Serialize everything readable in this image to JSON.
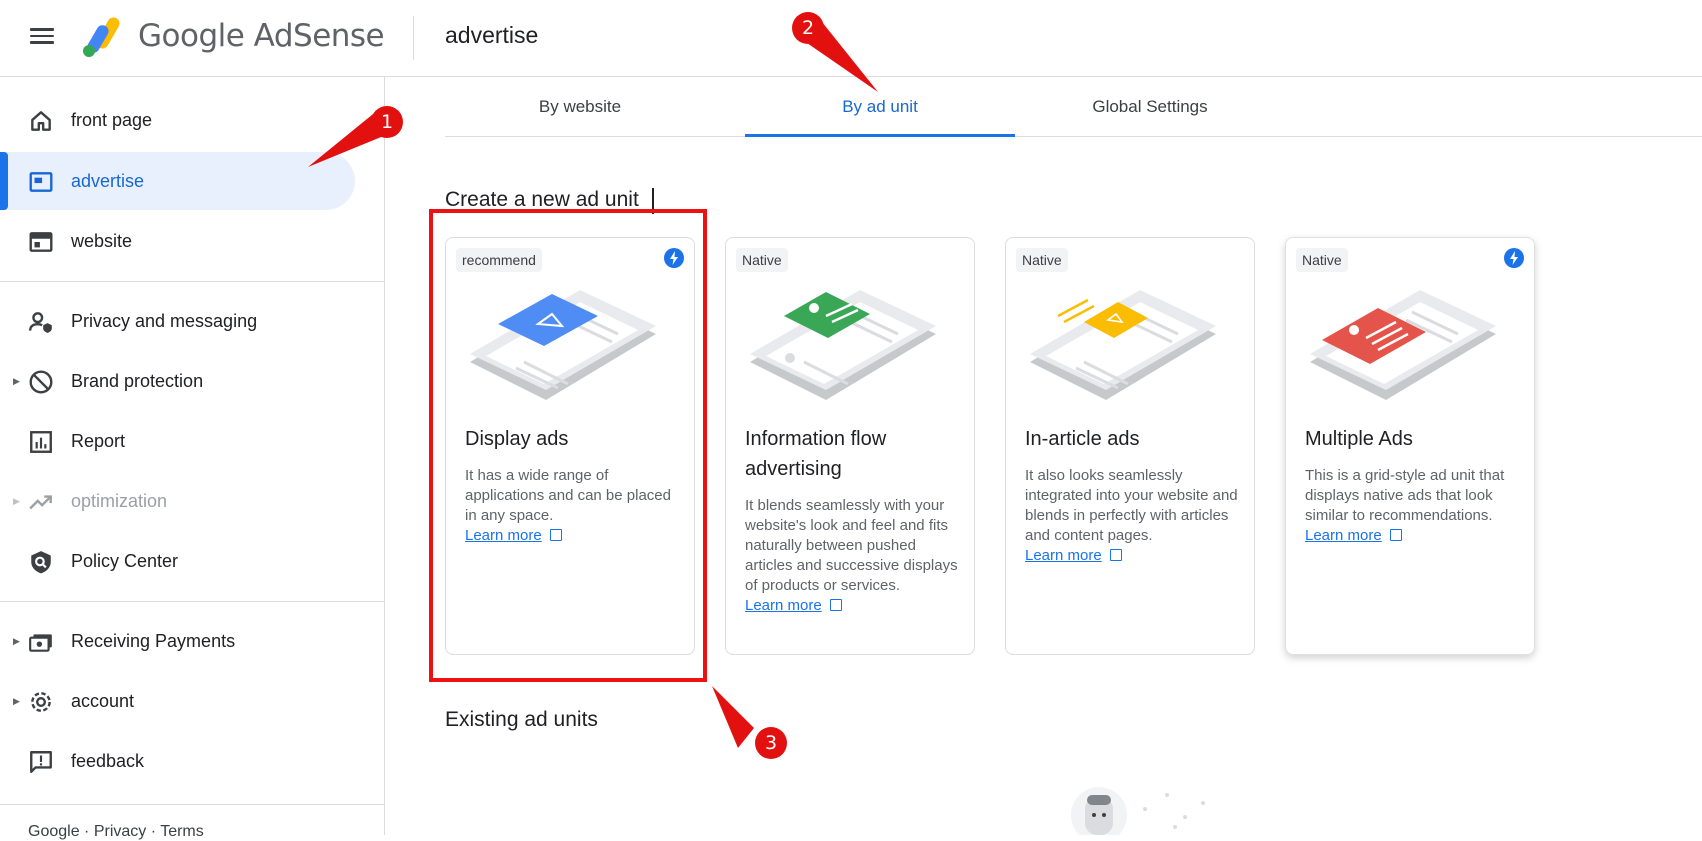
{
  "header": {
    "brand": "Google AdSense",
    "page_heading": "advertise"
  },
  "sidebar": {
    "items": [
      {
        "label": "front page",
        "icon": "home-icon"
      },
      {
        "label": "advertise",
        "icon": "ads-icon",
        "active": true
      },
      {
        "label": "website",
        "icon": "web-icon"
      },
      {
        "label": "Privacy and messaging",
        "icon": "privacy-icon"
      },
      {
        "label": "Brand protection",
        "icon": "block-icon",
        "expandable": true
      },
      {
        "label": "Report",
        "icon": "report-icon"
      },
      {
        "label": "optimization",
        "icon": "trending-icon",
        "expandable": true,
        "disabled": true
      },
      {
        "label": "Policy Center",
        "icon": "policy-icon"
      },
      {
        "label": "Receiving Payments",
        "icon": "payments-icon",
        "expandable": true
      },
      {
        "label": "account",
        "icon": "gear-icon",
        "expandable": true
      },
      {
        "label": "feedback",
        "icon": "feedback-icon"
      }
    ],
    "footer": "Google · Privacy · Terms"
  },
  "tabs": [
    {
      "label": "By website"
    },
    {
      "label": "By ad unit",
      "active": true
    },
    {
      "label": "Global Settings"
    }
  ],
  "main": {
    "create_title": "Create a new ad unit",
    "existing_title": "Existing ad units",
    "cards": [
      {
        "tag": "recommend",
        "has_bolt": true,
        "title": "Display ads",
        "description": "It has a wide range of applications and can be placed in any space.",
        "link": "Learn more",
        "accent": "#4f8df5"
      },
      {
        "tag": "Native",
        "has_bolt": false,
        "title": "Information flow advertising",
        "description": "It blends seamlessly with your website's look and feel and fits naturally between pushed articles and successive displays of products or services.",
        "link": "Learn more",
        "accent": "#3aa757"
      },
      {
        "tag": "Native",
        "has_bolt": false,
        "title": "In-article ads",
        "description": "It also looks seamlessly integrated into your website and blends in perfectly with articles and content pages.",
        "link": "Learn more",
        "accent": "#fbbc04"
      },
      {
        "tag": "Native",
        "has_bolt": true,
        "title": "Multiple Ads",
        "description": "This is a grid-style ad unit that displays native ads that look similar to recommendations.",
        "link": "Learn more",
        "accent": "#e5544b"
      }
    ]
  },
  "annotations": [
    "1",
    "2",
    "3"
  ],
  "colors": {
    "primary": "#1a73e8",
    "active_bg": "#e8f0fe",
    "annotation_red": "#e31010"
  }
}
